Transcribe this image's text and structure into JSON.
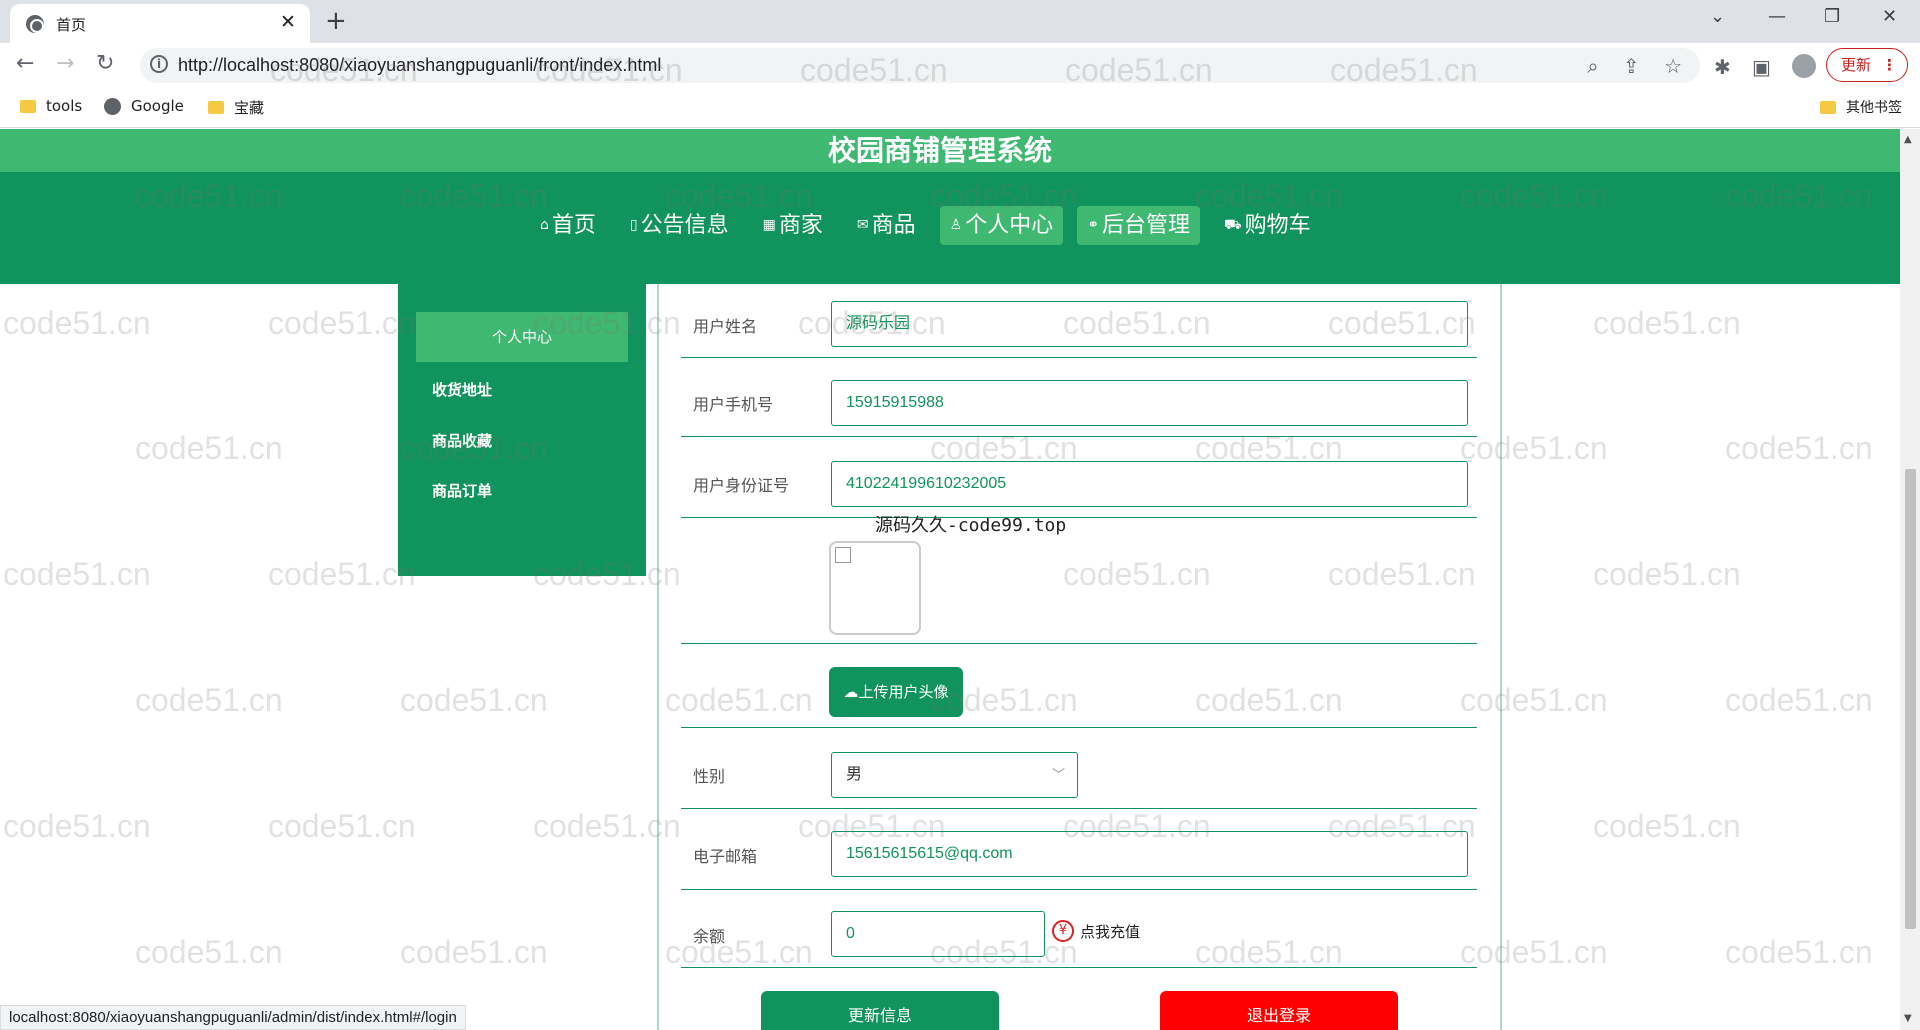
{
  "browser": {
    "tab_title": "首页",
    "url": "http://localhost:8080/xiaoyuanshangpuguanli/front/index.html",
    "update_label": "更新",
    "bookmarks": [
      "tools",
      "Google",
      "宝藏"
    ],
    "other_bookmarks": "其他书签",
    "status_url": "localhost:8080/xiaoyuanshangpuguanli/admin/dist/index.html#/login"
  },
  "site": {
    "title": "校园商铺管理系统",
    "nav": [
      {
        "label": "首页",
        "icon": "home-icon"
      },
      {
        "label": "公告信息",
        "icon": "notice-icon"
      },
      {
        "label": "商家",
        "icon": "shop-icon"
      },
      {
        "label": "商品",
        "icon": "mail-icon"
      },
      {
        "label": "个人中心",
        "icon": "user-icon",
        "active": true
      },
      {
        "label": "后台管理",
        "icon": "link-icon",
        "hover": true
      },
      {
        "label": "购物车",
        "icon": "cart-icon"
      }
    ]
  },
  "sidebar": {
    "items": [
      {
        "label": "个人中心",
        "active": true
      },
      {
        "label": "收货地址"
      },
      {
        "label": "商品收藏"
      },
      {
        "label": "商品订单"
      }
    ]
  },
  "form": {
    "name_label": "用户姓名",
    "name_value": "源码乐园",
    "phone_label": "用户手机号",
    "phone_value": "15915915988",
    "idcard_label": "用户身份证号",
    "idcard_value": "410224199610232005",
    "avatar_caption": "源码久久-code99.top",
    "upload_label": "上传用户头像",
    "gender_label": "性别",
    "gender_value": "男",
    "email_label": "电子邮箱",
    "email_value": "15615615615@qq.com",
    "balance_label": "余额",
    "balance_value": "0",
    "recharge_label": "点我充值",
    "update_button": "更新信息",
    "logout_button": "退出登录"
  },
  "watermark": "code51.cn",
  "colors": {
    "primary": "#10935c",
    "title_bar": "#3fb871",
    "danger": "#ff0000"
  }
}
